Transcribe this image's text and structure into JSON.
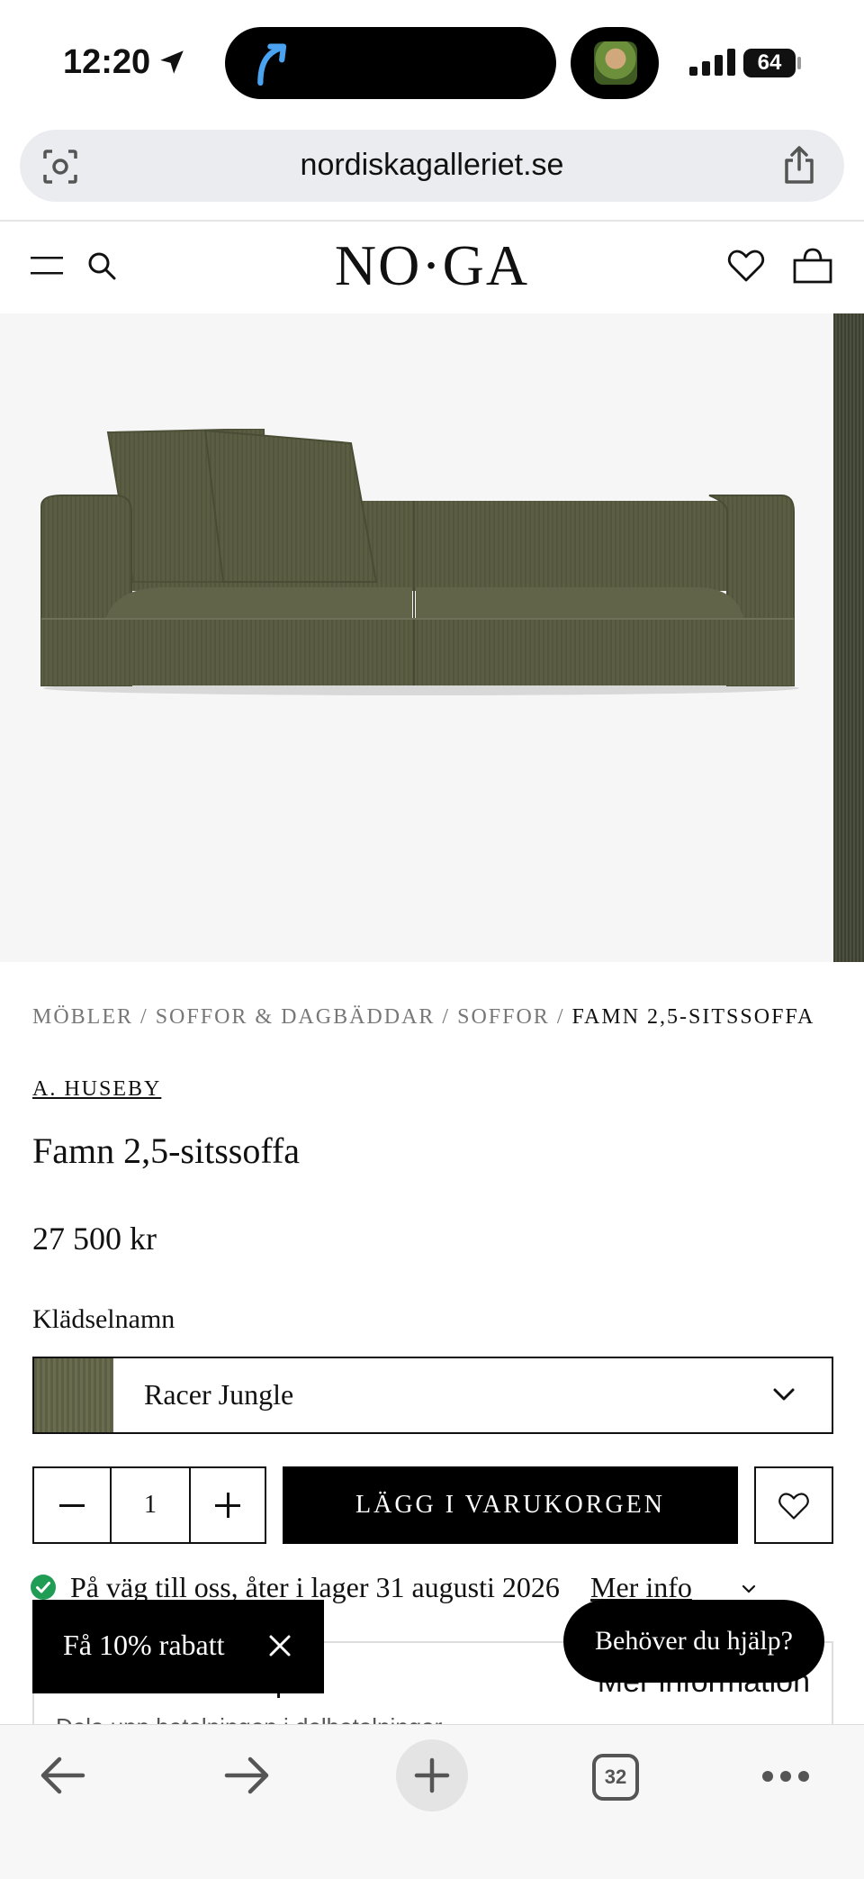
{
  "status_bar": {
    "time": "12:20",
    "battery": "64"
  },
  "browser": {
    "url": "nordiskagalleriet.se",
    "tab_count": "32"
  },
  "site": {
    "logo": "NO·GA"
  },
  "breadcrumb": {
    "items": [
      "MÖBLER",
      "SOFFOR & DAGBÄDDAR",
      "SOFFOR"
    ],
    "separator": " / ",
    "current": "FAMN 2,5-SITSSOFFA"
  },
  "product": {
    "brand": "A. HUSEBY",
    "title": "Famn 2,5-sitssoffa",
    "price": "27 500 kr",
    "fabric_label": "Klädselnamn",
    "fabric_value": "Racer Jungle",
    "quantity": "1",
    "add_to_cart": "LÄGG I VARUKORGEN",
    "stock_text": "På väg till oss, åter i lager 31 augusti 2026",
    "more_info": "Mer info"
  },
  "payment_box": {
    "title": "Delbetala ditt köp",
    "more": "Mer information",
    "sub": "Dela upp betalningen i delbetalningar"
  },
  "promo": {
    "text": "Få 10% rabatt"
  },
  "help": {
    "text": "Behöver du hjälp?"
  },
  "colors": {
    "sofa": "#5b5e43",
    "accent_check": "#1f9d55"
  }
}
